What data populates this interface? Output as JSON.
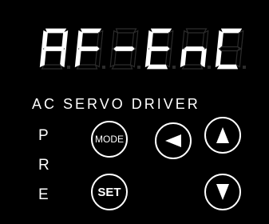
{
  "display": {
    "readout": "AF-EnC",
    "active_color": "#ffffff",
    "segment_off_color": "#2c2c2c"
  },
  "panel": {
    "label": "AC SERVO DRIVER",
    "side_letters": [
      "P",
      "R",
      "E"
    ],
    "background_color": "#000000"
  },
  "buttons": {
    "mode_label": "MODE",
    "set_label": "SET",
    "left_icon": "left-arrow-icon",
    "up_icon": "up-arrow-icon",
    "down_icon": "down-arrow-icon"
  }
}
